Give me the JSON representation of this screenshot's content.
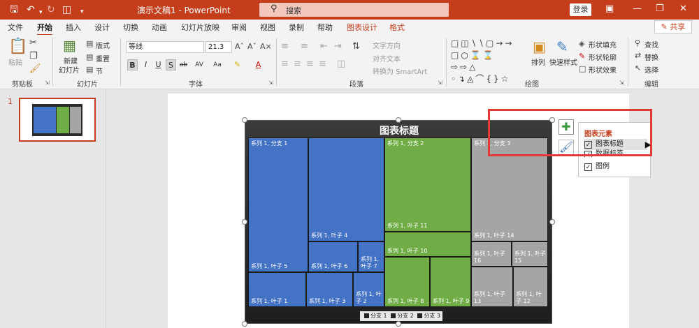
{
  "titlebar": {
    "doc_title": "演示文稿1  -  PowerPoint",
    "search_placeholder": "搜索",
    "login": "登录"
  },
  "tabs": [
    "文件",
    "开始",
    "插入",
    "设计",
    "切换",
    "动画",
    "幻灯片放映",
    "审阅",
    "视图",
    "录制",
    "帮助",
    "图表设计",
    "格式"
  ],
  "share_label": "共享",
  "ribbon": {
    "clipboard": {
      "label": "剪贴板",
      "paste": "粘贴"
    },
    "slides": {
      "label": "幻灯片",
      "new_slide": "新建",
      "new_slide2": "幻灯片",
      "layout": "版式",
      "reset": "重置",
      "section": "节"
    },
    "font": {
      "label": "字体",
      "name": "等线",
      "size": "21.3"
    },
    "paragraph": {
      "label": "段落",
      "text_direction": "文字方向",
      "align_text": "对齐文本",
      "smartart": "转换为 SmartArt"
    },
    "drawing": {
      "label": "绘图",
      "arrange": "排列",
      "quick_styles": "快速样式",
      "shape_fill": "形状填充",
      "shape_outline": "形状轮廓",
      "shape_effects": "形状效果"
    },
    "editing": {
      "label": "编辑",
      "find": "查找",
      "replace": "替换",
      "select": "选择"
    }
  },
  "slide_number": "1",
  "chart_data": {
    "type": "treemap",
    "title": "图表标题",
    "legend": [
      "分支 1",
      "分支 2",
      "分支 3"
    ],
    "legend_position": "bottom",
    "branch_colors": {
      "分支 1": "#4472c4",
      "分支 2": "#70ad47",
      "分支 3": "#a5a5a5"
    },
    "branch_labels": [
      "系列 1, 分支 1",
      "系列 1, 分支 2",
      "系列 1, 分支 3"
    ],
    "leaves": [
      {
        "branch": "分支 1",
        "label": "系列 1, 叶子 5"
      },
      {
        "branch": "分支 1",
        "label": "系列 1, 叶子 4"
      },
      {
        "branch": "分支 1",
        "label": "系列 1, 叶子 6"
      },
      {
        "branch": "分支 1",
        "label": "系列 1, 叶子 7"
      },
      {
        "branch": "分支 1",
        "label": "系列 1, 叶子 1"
      },
      {
        "branch": "分支 1",
        "label": "系列 1, 叶子 3"
      },
      {
        "branch": "分支 1",
        "label": "系列 1, 叶子 2"
      },
      {
        "branch": "分支 2",
        "label": "系列 1, 叶子 11"
      },
      {
        "branch": "分支 2",
        "label": "系列 1, 叶子 10"
      },
      {
        "branch": "分支 2",
        "label": "系列 1, 叶子 8"
      },
      {
        "branch": "分支 2",
        "label": "系列 1, 叶子 9"
      },
      {
        "branch": "分支 3",
        "label": "系列 1, 叶子 14"
      },
      {
        "branch": "分支 3",
        "label": "系列 1, 叶子 16"
      },
      {
        "branch": "分支 3",
        "label": "系列 1, 叶子 15"
      },
      {
        "branch": "分支 3",
        "label": "系列 1, 叶子 13"
      },
      {
        "branch": "分支 3",
        "label": "系列 1, 叶子 12"
      }
    ]
  },
  "chart_elements": {
    "header": "图表元素",
    "options": [
      {
        "label": "图表标题",
        "checked": true
      },
      {
        "label": "数据标签",
        "checked": true
      },
      {
        "label": "图例",
        "checked": true
      }
    ]
  }
}
